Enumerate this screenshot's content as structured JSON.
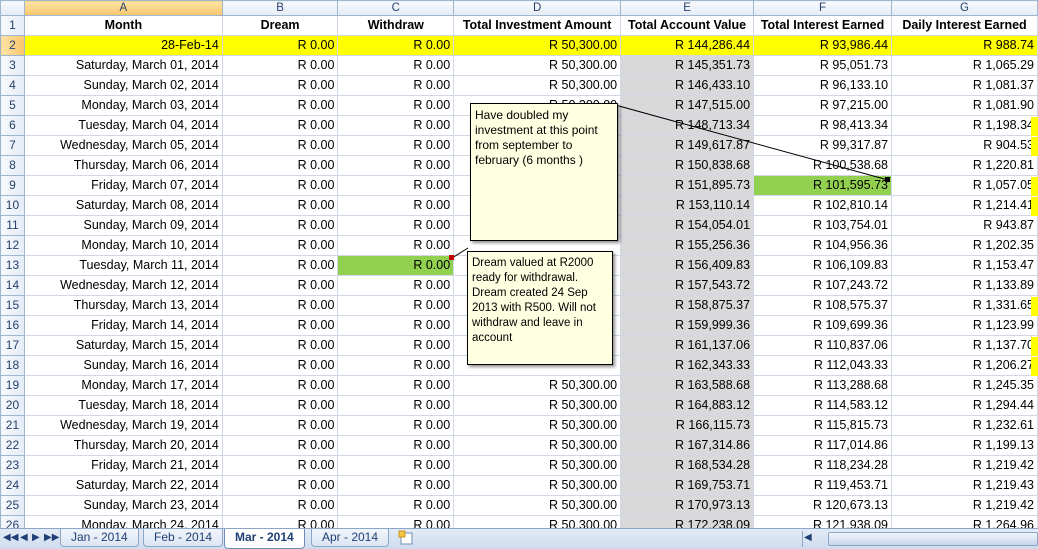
{
  "columns": [
    "A",
    "B",
    "C",
    "D",
    "E",
    "F",
    "G"
  ],
  "header_row": {
    "num": "1",
    "cells": [
      "Month",
      "Dream",
      "Withdraw",
      "Total Investment Amount",
      "Total Account Value",
      "Total Interest Earned",
      "Daily Interest Earned"
    ]
  },
  "rows": [
    {
      "num": "2",
      "cells": [
        "28-Feb-14",
        "R 0.00",
        "R 0.00",
        "R 50,300.00",
        "R 144,286.44",
        "R 93,986.44",
        "R 988.74"
      ]
    },
    {
      "num": "3",
      "cells": [
        "Saturday, March 01, 2014",
        "R 0.00",
        "R 0.00",
        "R 50,300.00",
        "R 145,351.73",
        "R 95,051.73",
        "R 1,065.29"
      ]
    },
    {
      "num": "4",
      "cells": [
        "Sunday, March 02, 2014",
        "R 0.00",
        "R 0.00",
        "R 50,300.00",
        "R 146,433.10",
        "R 96,133.10",
        "R 1,081.37"
      ]
    },
    {
      "num": "5",
      "cells": [
        "Monday, March 03, 2014",
        "R 0.00",
        "R 0.00",
        "R 50,300.00",
        "R 147,515.00",
        "R 97,215.00",
        "R 1,081.90"
      ]
    },
    {
      "num": "6",
      "cells": [
        "Tuesday, March 04, 2014",
        "R 0.00",
        "R 0.00",
        "",
        "R 148,713.34",
        "R 98,413.34",
        "R 1,198.34"
      ]
    },
    {
      "num": "7",
      "cells": [
        "Wednesday, March 05, 2014",
        "R 0.00",
        "R 0.00",
        "",
        "R 149,617.87",
        "R 99,317.87",
        "R 904.53"
      ]
    },
    {
      "num": "8",
      "cells": [
        "Thursday, March 06, 2014",
        "R 0.00",
        "R 0.00",
        "",
        "R 150,838.68",
        "R 100,538.68",
        "R 1,220.81"
      ]
    },
    {
      "num": "9",
      "cells": [
        "Friday, March 07, 2014",
        "R 0.00",
        "R 0.00",
        "",
        "R 151,895.73",
        "R 101,595.73",
        "R 1,057.05"
      ]
    },
    {
      "num": "10",
      "cells": [
        "Saturday, March 08, 2014",
        "R 0.00",
        "R 0.00",
        "",
        "R 153,110.14",
        "R 102,810.14",
        "R 1,214.41"
      ]
    },
    {
      "num": "11",
      "cells": [
        "Sunday, March 09, 2014",
        "R 0.00",
        "R 0.00",
        "",
        "R 154,054.01",
        "R 103,754.01",
        "R 943.87"
      ]
    },
    {
      "num": "12",
      "cells": [
        "Monday, March 10, 2014",
        "R 0.00",
        "R 0.00",
        "",
        "R 155,256.36",
        "R 104,956.36",
        "R 1,202.35"
      ]
    },
    {
      "num": "13",
      "cells": [
        "Tuesday, March 11, 2014",
        "R 0.00",
        "R 0.00",
        "",
        "R 156,409.83",
        "R 106,109.83",
        "R 1,153.47"
      ]
    },
    {
      "num": "14",
      "cells": [
        "Wednesday, March 12, 2014",
        "R 0.00",
        "R 0.00",
        "",
        "R 157,543.72",
        "R 107,243.72",
        "R 1,133.89"
      ]
    },
    {
      "num": "15",
      "cells": [
        "Thursday, March 13, 2014",
        "R 0.00",
        "R 0.00",
        "",
        "R 158,875.37",
        "R 108,575.37",
        "R 1,331.65"
      ]
    },
    {
      "num": "16",
      "cells": [
        "Friday, March 14, 2014",
        "R 0.00",
        "R 0.00",
        "",
        "R 159,999.36",
        "R 109,699.36",
        "R 1,123.99"
      ]
    },
    {
      "num": "17",
      "cells": [
        "Saturday, March 15, 2014",
        "R 0.00",
        "R 0.00",
        "",
        "R 161,137.06",
        "R 110,837.06",
        "R 1,137.70"
      ]
    },
    {
      "num": "18",
      "cells": [
        "Sunday, March 16, 2014",
        "R 0.00",
        "R 0.00",
        "",
        "R 162,343.33",
        "R 112,043.33",
        "R 1,206.27"
      ]
    },
    {
      "num": "19",
      "cells": [
        "Monday, March 17, 2014",
        "R 0.00",
        "R 0.00",
        "R 50,300.00",
        "R 163,588.68",
        "R 113,288.68",
        "R 1,245.35"
      ]
    },
    {
      "num": "20",
      "cells": [
        "Tuesday, March 18, 2014",
        "R 0.00",
        "R 0.00",
        "R 50,300.00",
        "R 164,883.12",
        "R 114,583.12",
        "R 1,294.44"
      ]
    },
    {
      "num": "21",
      "cells": [
        "Wednesday, March 19, 2014",
        "R 0.00",
        "R 0.00",
        "R 50,300.00",
        "R 166,115.73",
        "R 115,815.73",
        "R 1,232.61"
      ]
    },
    {
      "num": "22",
      "cells": [
        "Thursday, March 20, 2014",
        "R 0.00",
        "R 0.00",
        "R 50,300.00",
        "R 167,314.86",
        "R 117,014.86",
        "R 1,199.13"
      ]
    },
    {
      "num": "23",
      "cells": [
        "Friday, March 21, 2014",
        "R 0.00",
        "R 0.00",
        "R 50,300.00",
        "R 168,534.28",
        "R 118,234.28",
        "R 1,219.42"
      ]
    },
    {
      "num": "24",
      "cells": [
        "Saturday, March 22, 2014",
        "R 0.00",
        "R 0.00",
        "R 50,300.00",
        "R 169,753.71",
        "R 119,453.71",
        "R 1,219.43"
      ]
    },
    {
      "num": "25",
      "cells": [
        "Sunday, March 23, 2014",
        "R 0.00",
        "R 0.00",
        "R 50,300.00",
        "R 170,973.13",
        "R 120,673.13",
        "R 1,219.42"
      ]
    },
    {
      "num": "26",
      "cells": [
        "Monday, March 24, 2014",
        "R 0.00",
        "R 0.00",
        "R 50,300.00",
        "R 172,238.09",
        "R 121,938.09",
        "R 1,264.96"
      ]
    }
  ],
  "comments": {
    "doubled": "Have doubled my investment at this point from september to february (6 months )",
    "dream": "Dream valued at R2000 ready for withdrawal. Dream created 24 Sep 2013 with R500. Will not withdraw and leave in account"
  },
  "sheet_tabs": [
    "Jan - 2014",
    "Feb - 2014",
    "Mar - 2014",
    "Apr - 2014"
  ],
  "active_tab": "Mar - 2014",
  "colors": {
    "yellow_highlight": "#ffff00",
    "green_highlight": "#92d050",
    "grey_column": "#d9d9d9",
    "comment_bg": "#ffffe1"
  }
}
